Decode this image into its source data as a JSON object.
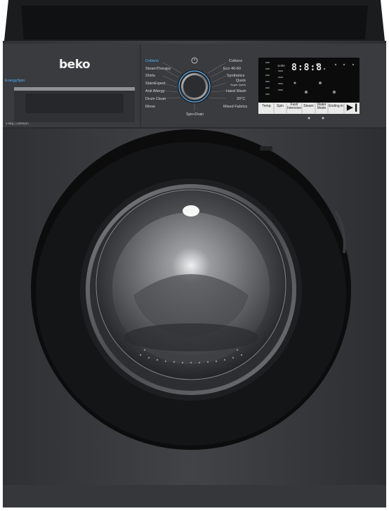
{
  "brand": "beko",
  "energy_label": "EnergySpin",
  "spec_label": "1-8kg | 1400rpm",
  "programs_left": [
    "Cottons",
    "SteamTherapy",
    "Shirts",
    "StainExpert",
    "Anti Allergy",
    "Drum Clean",
    "Rinse"
  ],
  "programs_right": [
    "Cottons",
    "Eco 40-60",
    "Synthetics",
    "Quick",
    "Hand Wash",
    "20°C",
    "Mixed Fabrics"
  ],
  "quick_sublabel": "Super Quick",
  "knob_label": "Spin+Drain",
  "display": {
    "digits": "8:8:8",
    "time": "1H00"
  },
  "buttons": [
    "Temp.",
    "Spin",
    "Fast/ Intensive",
    "Steam",
    "Water Mode",
    "Ending in"
  ],
  "colors": {
    "body": "#3b3d40",
    "panel": "#35373a",
    "display": "#0b0b0c",
    "buttons": "#e8e8e8",
    "accent_blue": "#4fb3ff"
  }
}
